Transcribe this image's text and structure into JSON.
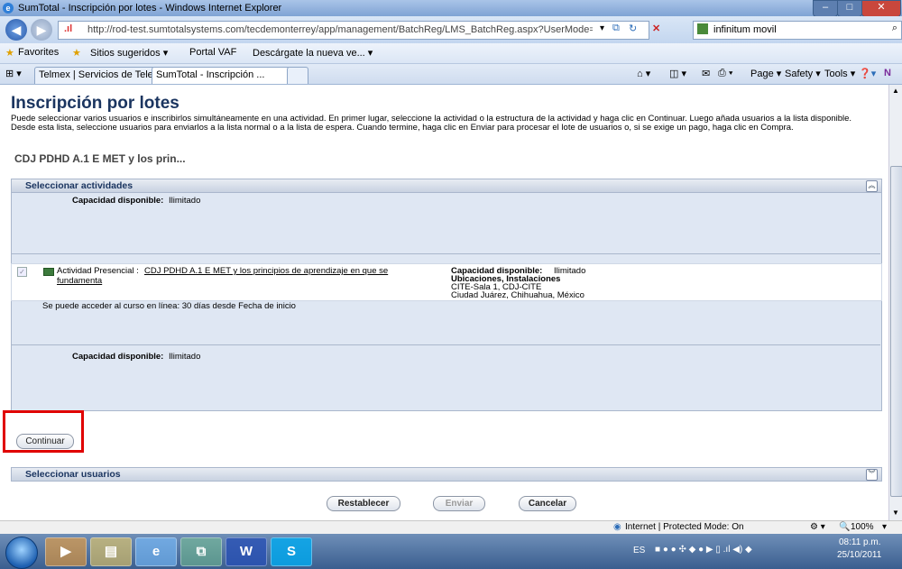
{
  "window": {
    "title": "SumTotal - Inscripción por lotes - Windows Internet Explorer",
    "controls": [
      "–",
      "□",
      "✕"
    ]
  },
  "address_bar": {
    "url": "http://rod-test.sumtotalsystems.com/tecdemonterrey/app/management/BatchReg/LMS_BatchReg.aspx?UserMode=2&ActivityID=9966&RegMod",
    "search_text": "infinitum movil"
  },
  "favorites_bar": {
    "favorites_label": "Favorites",
    "items": [
      "Sitios sugeridos ▾",
      "Portal VAF",
      "Descárgate la nueva ve... ▾"
    ]
  },
  "tabs": [
    {
      "label": "Telmex | Servicios de Telef..."
    },
    {
      "label": "SumTotal - Inscripción ..."
    }
  ],
  "command_bar": {
    "items": [
      "Page ▾",
      "Safety ▾",
      "Tools ▾"
    ]
  },
  "page": {
    "title": "Inscripción por lotes",
    "intro": "Puede seleccionar varios usuarios e inscribirlos simultáneamente en una actividad. En primer lugar, seleccione la actividad o la estructura de la actividad y haga clic en Continuar. Luego añada usuarios a la lista disponible. Desde esta lista, seleccione usuarios para enviarlos a la lista normal o a la lista de espera. Cuando termine, haga clic en Enviar para procesar el lote de usuarios o, si se exige un pago, haga clic en Compra.",
    "subtitle": "CDJ PDHD A.1 E MET y los prin...",
    "select_activities": {
      "header": "Seleccionar actividades",
      "capacity_label": "Capacidad disponible:",
      "capacity_value": "Ilimitado",
      "activity": {
        "type_label": "Actividad Presencial :",
        "name": "CDJ PDHD A.1 E MET y los principios de aprendizaje en que se fundamenta",
        "capacity_label": "Capacidad disponible:",
        "capacity_value": "Ilimitado",
        "locations_label": "Ubicaciones, Instalaciones",
        "location_line1": "CITE-Sala 1, CDJ-CITE",
        "location_line2": "Ciudad Juárez, Chihuahua, México",
        "access_note": "Se puede acceder al curso en línea: 30 días desde Fecha de inicio"
      }
    },
    "continue_button": "Continuar",
    "select_users": {
      "header": "Seleccionar usuarios"
    },
    "buttons": {
      "reset": "Restablecer",
      "send": "Enviar",
      "cancel": "Cancelar"
    }
  },
  "status_bar": {
    "zone": "Internet | Protected Mode: On",
    "zoom": "100%"
  },
  "taskbar": {
    "lang": "ES",
    "time": "08:11 p.m.",
    "date": "25/10/2011"
  },
  "colors": {
    "title_blue": "#1b3560",
    "highlight_red": "#e00000",
    "panel_bg": "#dfe7f3"
  }
}
